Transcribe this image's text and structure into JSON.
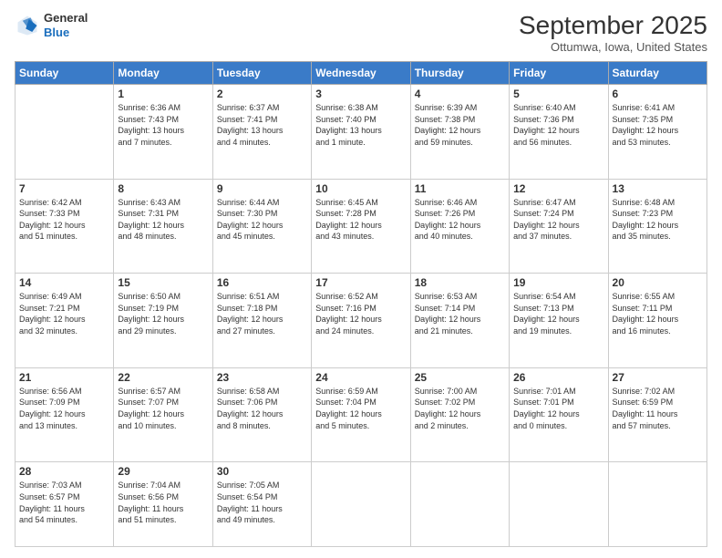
{
  "header": {
    "logo": {
      "general": "General",
      "blue": "Blue"
    },
    "title": "September 2025",
    "location": "Ottumwa, Iowa, United States"
  },
  "days_of_week": [
    "Sunday",
    "Monday",
    "Tuesday",
    "Wednesday",
    "Thursday",
    "Friday",
    "Saturday"
  ],
  "weeks": [
    [
      {
        "day": "",
        "info": ""
      },
      {
        "day": "1",
        "info": "Sunrise: 6:36 AM\nSunset: 7:43 PM\nDaylight: 13 hours\nand 7 minutes."
      },
      {
        "day": "2",
        "info": "Sunrise: 6:37 AM\nSunset: 7:41 PM\nDaylight: 13 hours\nand 4 minutes."
      },
      {
        "day": "3",
        "info": "Sunrise: 6:38 AM\nSunset: 7:40 PM\nDaylight: 13 hours\nand 1 minute."
      },
      {
        "day": "4",
        "info": "Sunrise: 6:39 AM\nSunset: 7:38 PM\nDaylight: 12 hours\nand 59 minutes."
      },
      {
        "day": "5",
        "info": "Sunrise: 6:40 AM\nSunset: 7:36 PM\nDaylight: 12 hours\nand 56 minutes."
      },
      {
        "day": "6",
        "info": "Sunrise: 6:41 AM\nSunset: 7:35 PM\nDaylight: 12 hours\nand 53 minutes."
      }
    ],
    [
      {
        "day": "7",
        "info": "Sunrise: 6:42 AM\nSunset: 7:33 PM\nDaylight: 12 hours\nand 51 minutes."
      },
      {
        "day": "8",
        "info": "Sunrise: 6:43 AM\nSunset: 7:31 PM\nDaylight: 12 hours\nand 48 minutes."
      },
      {
        "day": "9",
        "info": "Sunrise: 6:44 AM\nSunset: 7:30 PM\nDaylight: 12 hours\nand 45 minutes."
      },
      {
        "day": "10",
        "info": "Sunrise: 6:45 AM\nSunset: 7:28 PM\nDaylight: 12 hours\nand 43 minutes."
      },
      {
        "day": "11",
        "info": "Sunrise: 6:46 AM\nSunset: 7:26 PM\nDaylight: 12 hours\nand 40 minutes."
      },
      {
        "day": "12",
        "info": "Sunrise: 6:47 AM\nSunset: 7:24 PM\nDaylight: 12 hours\nand 37 minutes."
      },
      {
        "day": "13",
        "info": "Sunrise: 6:48 AM\nSunset: 7:23 PM\nDaylight: 12 hours\nand 35 minutes."
      }
    ],
    [
      {
        "day": "14",
        "info": "Sunrise: 6:49 AM\nSunset: 7:21 PM\nDaylight: 12 hours\nand 32 minutes."
      },
      {
        "day": "15",
        "info": "Sunrise: 6:50 AM\nSunset: 7:19 PM\nDaylight: 12 hours\nand 29 minutes."
      },
      {
        "day": "16",
        "info": "Sunrise: 6:51 AM\nSunset: 7:18 PM\nDaylight: 12 hours\nand 27 minutes."
      },
      {
        "day": "17",
        "info": "Sunrise: 6:52 AM\nSunset: 7:16 PM\nDaylight: 12 hours\nand 24 minutes."
      },
      {
        "day": "18",
        "info": "Sunrise: 6:53 AM\nSunset: 7:14 PM\nDaylight: 12 hours\nand 21 minutes."
      },
      {
        "day": "19",
        "info": "Sunrise: 6:54 AM\nSunset: 7:13 PM\nDaylight: 12 hours\nand 19 minutes."
      },
      {
        "day": "20",
        "info": "Sunrise: 6:55 AM\nSunset: 7:11 PM\nDaylight: 12 hours\nand 16 minutes."
      }
    ],
    [
      {
        "day": "21",
        "info": "Sunrise: 6:56 AM\nSunset: 7:09 PM\nDaylight: 12 hours\nand 13 minutes."
      },
      {
        "day": "22",
        "info": "Sunrise: 6:57 AM\nSunset: 7:07 PM\nDaylight: 12 hours\nand 10 minutes."
      },
      {
        "day": "23",
        "info": "Sunrise: 6:58 AM\nSunset: 7:06 PM\nDaylight: 12 hours\nand 8 minutes."
      },
      {
        "day": "24",
        "info": "Sunrise: 6:59 AM\nSunset: 7:04 PM\nDaylight: 12 hours\nand 5 minutes."
      },
      {
        "day": "25",
        "info": "Sunrise: 7:00 AM\nSunset: 7:02 PM\nDaylight: 12 hours\nand 2 minutes."
      },
      {
        "day": "26",
        "info": "Sunrise: 7:01 AM\nSunset: 7:01 PM\nDaylight: 12 hours\nand 0 minutes."
      },
      {
        "day": "27",
        "info": "Sunrise: 7:02 AM\nSunset: 6:59 PM\nDaylight: 11 hours\nand 57 minutes."
      }
    ],
    [
      {
        "day": "28",
        "info": "Sunrise: 7:03 AM\nSunset: 6:57 PM\nDaylight: 11 hours\nand 54 minutes."
      },
      {
        "day": "29",
        "info": "Sunrise: 7:04 AM\nSunset: 6:56 PM\nDaylight: 11 hours\nand 51 minutes."
      },
      {
        "day": "30",
        "info": "Sunrise: 7:05 AM\nSunset: 6:54 PM\nDaylight: 11 hours\nand 49 minutes."
      },
      {
        "day": "",
        "info": ""
      },
      {
        "day": "",
        "info": ""
      },
      {
        "day": "",
        "info": ""
      },
      {
        "day": "",
        "info": ""
      }
    ]
  ]
}
